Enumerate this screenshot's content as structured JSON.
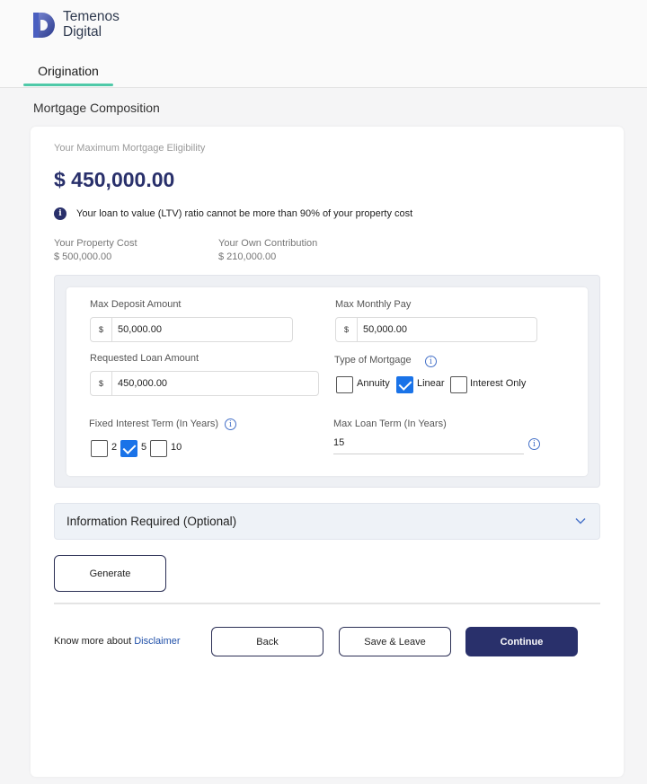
{
  "brand": {
    "line1": "Temenos",
    "line2": "Digital"
  },
  "tabs": [
    {
      "label": "Origination",
      "active": true
    }
  ],
  "page_title": "Mortgage Composition",
  "eligibility": {
    "label": "Your Maximum Mortgage Eligibility",
    "amount": "$ 450,000.00",
    "info": "Your loan to value (LTV) ratio cannot be more than 90% of your property cost"
  },
  "summary": {
    "property_cost_label": "Your Property Cost",
    "property_cost_value": "$ 500,000.00",
    "own_contribution_label": "Your Own Contribution",
    "own_contribution_value": "$ 210,000.00"
  },
  "form": {
    "max_deposit": {
      "label": "Max Deposit Amount",
      "currency": "$",
      "value": "50,000.00"
    },
    "max_monthly": {
      "label": "Max Monthly Pay",
      "currency": "$",
      "value": "50,000.00"
    },
    "requested_loan": {
      "label": "Requested Loan Amount",
      "currency": "$",
      "value": "450,000.00"
    },
    "mortgage_type": {
      "label": "Type of Mortgage",
      "options": [
        {
          "label": "Annuity",
          "checked": false
        },
        {
          "label": "Linear",
          "checked": true
        },
        {
          "label": "Interest Only",
          "checked": false
        }
      ]
    },
    "fixed_interest_term": {
      "label": "Fixed Interest Term (In Years)",
      "options": [
        {
          "label": "2",
          "checked": false
        },
        {
          "label": "5",
          "checked": true
        },
        {
          "label": "10",
          "checked": false
        }
      ]
    },
    "max_loan_term": {
      "label": "Max Loan Term (In Years)",
      "value": "15"
    }
  },
  "accordion": {
    "title": "Information Required (Optional)"
  },
  "buttons": {
    "generate": "Generate",
    "back": "Back",
    "save_leave": "Save & Leave",
    "continue": "Continue"
  },
  "footer": {
    "know_more": "Know more about",
    "disclaimer": "Disclaimer"
  },
  "colors": {
    "primary": "#29306b",
    "accent": "#4fc9a8",
    "checkbox": "#1a73e8"
  }
}
